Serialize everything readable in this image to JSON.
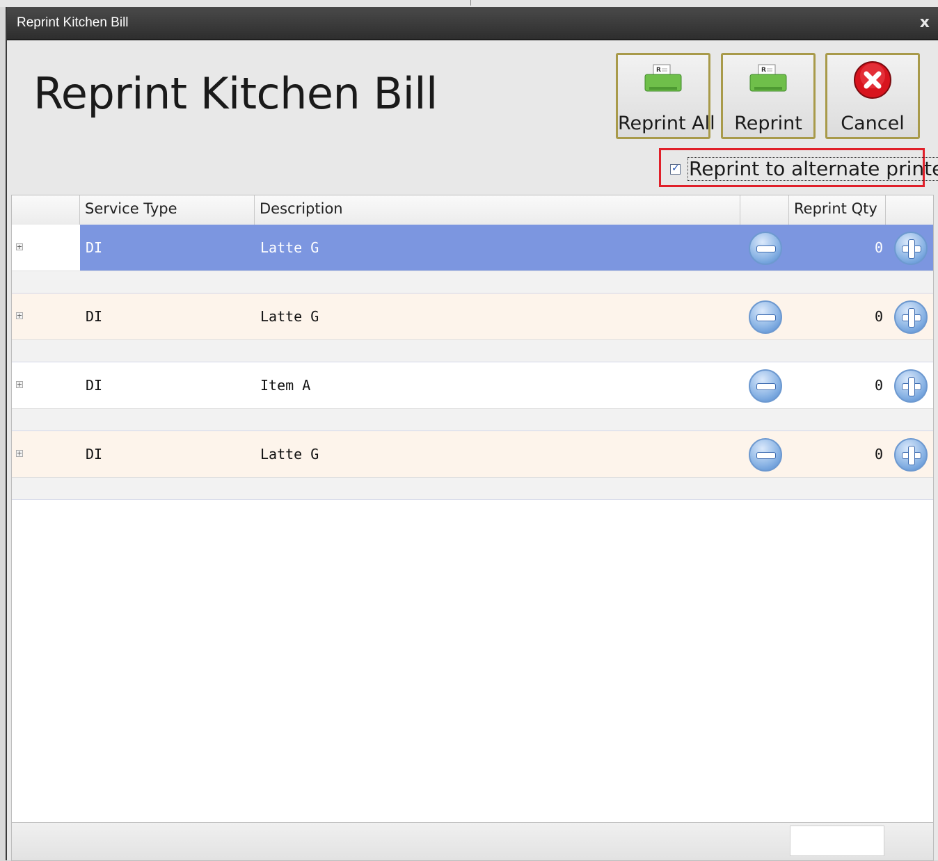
{
  "window": {
    "title": "Reprint Kitchen Bill",
    "close_glyph": "x"
  },
  "header": {
    "heading": "Reprint Kitchen Bill"
  },
  "toolbar": {
    "reprint_all_label": "Reprint All",
    "reprint_label": "Reprint",
    "cancel_label": "Cancel",
    "reprint_icon": "printer-icon",
    "cancel_icon": "cancel-x-icon"
  },
  "options": {
    "alternate_printer_label": "Reprint to alternate printer",
    "alternate_printer_checked": true
  },
  "grid": {
    "columns": [
      "",
      "Service Type",
      "Description",
      "",
      "Reprint Qty",
      ""
    ],
    "rows": [
      {
        "service_type": "DI",
        "description": "Latte G",
        "qty": "0",
        "selected": true
      },
      {
        "service_type": "DI",
        "description": "Latte G",
        "qty": "0",
        "selected": false
      },
      {
        "service_type": "DI",
        "description": "Item A",
        "qty": "0",
        "selected": false
      },
      {
        "service_type": "DI",
        "description": "Latte G",
        "qty": "0",
        "selected": false
      }
    ]
  },
  "colors": {
    "selected_row": "#7c96e0",
    "alt_row": "#fdf4eb",
    "highlight_border": "#e0202a",
    "button_border": "#a89a4a"
  }
}
